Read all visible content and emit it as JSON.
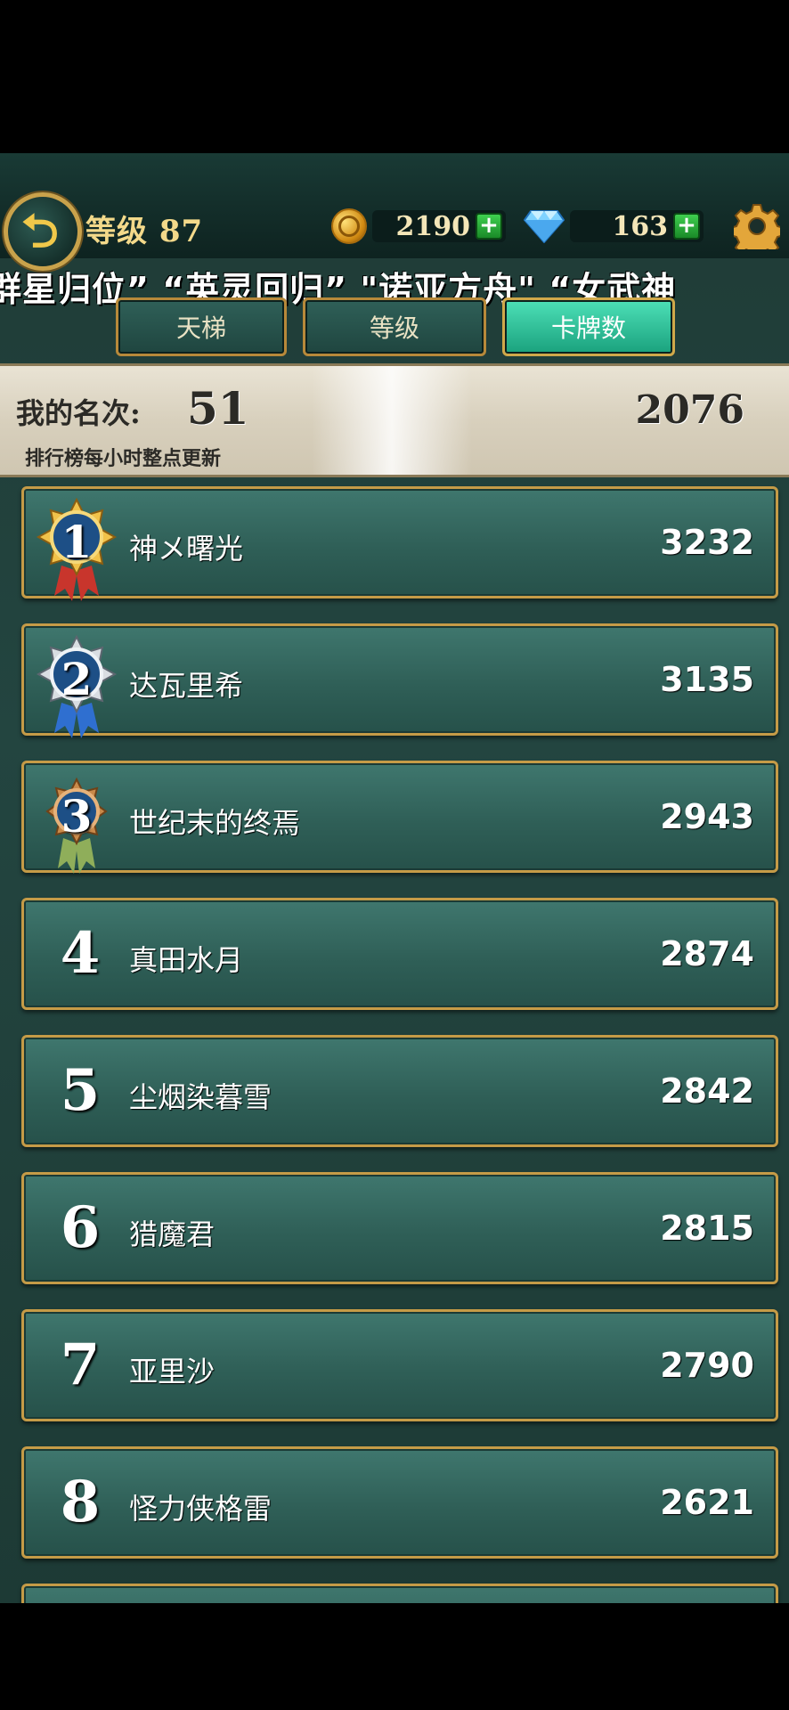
{
  "header": {
    "level_label": "等级 87",
    "coins": "2190",
    "gems": "163",
    "ticker": "群星归位” “英灵回归” \"诺亚方舟\" “女武神"
  },
  "tabs": [
    {
      "label": "天梯",
      "active": false
    },
    {
      "label": "等级",
      "active": false
    },
    {
      "label": "卡牌数",
      "active": true
    }
  ],
  "my_rank": {
    "label": "我的名次:",
    "rank": "51",
    "score": "2076",
    "note": "排行榜每小时整点更新"
  },
  "leaderboard": [
    {
      "rank": "1",
      "name": "神メ曙光",
      "score": "3232",
      "medal": "gold"
    },
    {
      "rank": "2",
      "name": "达瓦里希",
      "score": "3135",
      "medal": "silver"
    },
    {
      "rank": "3",
      "name": "世纪末的终焉",
      "score": "2943",
      "medal": "bronze"
    },
    {
      "rank": "4",
      "name": "真田水月",
      "score": "2874"
    },
    {
      "rank": "5",
      "name": "尘烟染暮雪",
      "score": "2842"
    },
    {
      "rank": "6",
      "name": "猎魔君",
      "score": "2815"
    },
    {
      "rank": "7",
      "name": "亚里沙",
      "score": "2790"
    },
    {
      "rank": "8",
      "name": "怪力侠格雷",
      "score": "2621"
    }
  ],
  "colors": {
    "row_border": "#c59b47",
    "active_tab": "#1aa17d",
    "background": "#234540"
  }
}
